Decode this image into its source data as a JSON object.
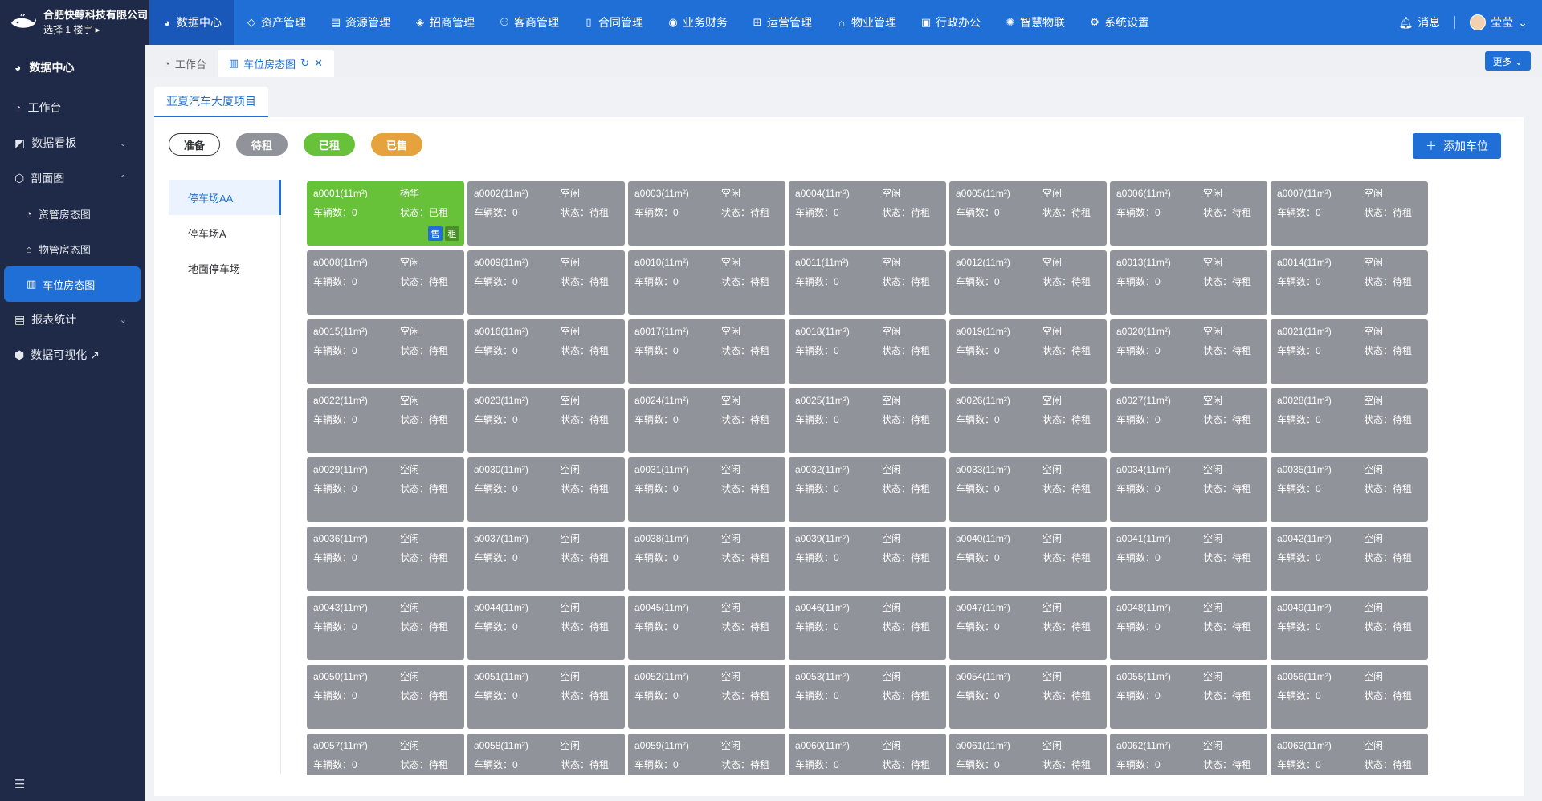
{
  "brand": {
    "company": "合肥快鲸科技有限公司",
    "building": "选择 1 楼宇 ▸"
  },
  "topnav": [
    {
      "label": "数据中心",
      "icon": "pie-chart-icon"
    },
    {
      "label": "资产管理",
      "icon": "box-icon"
    },
    {
      "label": "资源管理",
      "icon": "building-icon"
    },
    {
      "label": "招商管理",
      "icon": "tag-icon"
    },
    {
      "label": "客商管理",
      "icon": "users-icon"
    },
    {
      "label": "合同管理",
      "icon": "document-icon"
    },
    {
      "label": "业务财务",
      "icon": "finance-icon"
    },
    {
      "label": "运营管理",
      "icon": "operation-icon"
    },
    {
      "label": "物业管理",
      "icon": "home-icon"
    },
    {
      "label": "行政办公",
      "icon": "office-icon"
    },
    {
      "label": "智慧物联",
      "icon": "iot-icon"
    },
    {
      "label": "系统设置",
      "icon": "gear-icon"
    }
  ],
  "header": {
    "messages": "消息",
    "user": "莹莹"
  },
  "sidebar": {
    "title": "数据中心",
    "items": [
      {
        "label": "工作台",
        "icon": "dashboard-icon",
        "arrow": ""
      },
      {
        "label": "数据看板",
        "icon": "chart-icon",
        "arrow": "⌄"
      },
      {
        "label": "剖面图",
        "icon": "section-icon",
        "arrow": "⌃"
      },
      {
        "label": "资管房态图",
        "icon": "pie-icon",
        "arrow": ""
      },
      {
        "label": "物管房态图",
        "icon": "house-icon",
        "arrow": ""
      },
      {
        "label": "车位房态图",
        "icon": "parking-icon",
        "arrow": ""
      },
      {
        "label": "报表统计",
        "icon": "report-icon",
        "arrow": "⌄"
      },
      {
        "label": "数据可视化 ↗",
        "icon": "visual-icon",
        "arrow": ""
      }
    ]
  },
  "tabs": [
    {
      "label": "工作台"
    },
    {
      "label": "车位房态图"
    }
  ],
  "more_label": "更多 ⌄",
  "project_tab": "亚夏汽车大厦项目",
  "legend": {
    "prep": "准备",
    "to_rent": "待租",
    "rented": "已租",
    "sold": "已售"
  },
  "add_button": "添加车位",
  "lots": [
    "停车场AA",
    "停车场A",
    "地面停车场"
  ],
  "colors": {
    "primary": "#1f6fd6",
    "idle": "#909399",
    "rented": "#67c23a",
    "sold": "#e6a23c",
    "sidebar": "#1e2a47"
  },
  "spaces": [
    {
      "name": "a0001(11m²)",
      "usage": "杨华",
      "vehicles": "车辆数：0",
      "status": "状态：已租",
      "highlight": true,
      "badge_sell": "售",
      "badge_rent": "租"
    },
    {
      "name": "a0002(11m²)",
      "usage": "空闲",
      "vehicles": "车辆数：0",
      "status": "状态：待租"
    },
    {
      "name": "a0003(11m²)",
      "usage": "空闲",
      "vehicles": "车辆数：0",
      "status": "状态：待租"
    },
    {
      "name": "a0004(11m²)",
      "usage": "空闲",
      "vehicles": "车辆数：0",
      "status": "状态：待租"
    },
    {
      "name": "a0005(11m²)",
      "usage": "空闲",
      "vehicles": "车辆数：0",
      "status": "状态：待租"
    },
    {
      "name": "a0006(11m²)",
      "usage": "空闲",
      "vehicles": "车辆数：0",
      "status": "状态：待租"
    },
    {
      "name": "a0007(11m²)",
      "usage": "空闲",
      "vehicles": "车辆数：0",
      "status": "状态：待租"
    },
    {
      "name": "a0008(11m²)",
      "usage": "空闲",
      "vehicles": "车辆数：0",
      "status": "状态：待租"
    },
    {
      "name": "a0009(11m²)",
      "usage": "空闲",
      "vehicles": "车辆数：0",
      "status": "状态：待租"
    },
    {
      "name": "a0010(11m²)",
      "usage": "空闲",
      "vehicles": "车辆数：0",
      "status": "状态：待租"
    },
    {
      "name": "a0011(11m²)",
      "usage": "空闲",
      "vehicles": "车辆数：0",
      "status": "状态：待租"
    },
    {
      "name": "a0012(11m²)",
      "usage": "空闲",
      "vehicles": "车辆数：0",
      "status": "状态：待租"
    },
    {
      "name": "a0013(11m²)",
      "usage": "空闲",
      "vehicles": "车辆数：0",
      "status": "状态：待租"
    },
    {
      "name": "a0014(11m²)",
      "usage": "空闲",
      "vehicles": "车辆数：0",
      "status": "状态：待租"
    },
    {
      "name": "a0015(11m²)",
      "usage": "空闲",
      "vehicles": "车辆数：0",
      "status": "状态：待租"
    },
    {
      "name": "a0016(11m²)",
      "usage": "空闲",
      "vehicles": "车辆数：0",
      "status": "状态：待租"
    },
    {
      "name": "a0017(11m²)",
      "usage": "空闲",
      "vehicles": "车辆数：0",
      "status": "状态：待租"
    },
    {
      "name": "a0018(11m²)",
      "usage": "空闲",
      "vehicles": "车辆数：0",
      "status": "状态：待租"
    },
    {
      "name": "a0019(11m²)",
      "usage": "空闲",
      "vehicles": "车辆数：0",
      "status": "状态：待租"
    },
    {
      "name": "a0020(11m²)",
      "usage": "空闲",
      "vehicles": "车辆数：0",
      "status": "状态：待租"
    },
    {
      "name": "a0021(11m²)",
      "usage": "空闲",
      "vehicles": "车辆数：0",
      "status": "状态：待租"
    },
    {
      "name": "a0022(11m²)",
      "usage": "空闲",
      "vehicles": "车辆数：0",
      "status": "状态：待租"
    },
    {
      "name": "a0023(11m²)",
      "usage": "空闲",
      "vehicles": "车辆数：0",
      "status": "状态：待租"
    },
    {
      "name": "a0024(11m²)",
      "usage": "空闲",
      "vehicles": "车辆数：0",
      "status": "状态：待租"
    },
    {
      "name": "a0025(11m²)",
      "usage": "空闲",
      "vehicles": "车辆数：0",
      "status": "状态：待租"
    },
    {
      "name": "a0026(11m²)",
      "usage": "空闲",
      "vehicles": "车辆数：0",
      "status": "状态：待租"
    },
    {
      "name": "a0027(11m²)",
      "usage": "空闲",
      "vehicles": "车辆数：0",
      "status": "状态：待租"
    },
    {
      "name": "a0028(11m²)",
      "usage": "空闲",
      "vehicles": "车辆数：0",
      "status": "状态：待租"
    },
    {
      "name": "a0029(11m²)",
      "usage": "空闲",
      "vehicles": "车辆数：0",
      "status": "状态：待租"
    },
    {
      "name": "a0030(11m²)",
      "usage": "空闲",
      "vehicles": "车辆数：0",
      "status": "状态：待租"
    },
    {
      "name": "a0031(11m²)",
      "usage": "空闲",
      "vehicles": "车辆数：0",
      "status": "状态：待租"
    },
    {
      "name": "a0032(11m²)",
      "usage": "空闲",
      "vehicles": "车辆数：0",
      "status": "状态：待租"
    },
    {
      "name": "a0033(11m²)",
      "usage": "空闲",
      "vehicles": "车辆数：0",
      "status": "状态：待租"
    },
    {
      "name": "a0034(11m²)",
      "usage": "空闲",
      "vehicles": "车辆数：0",
      "status": "状态：待租"
    },
    {
      "name": "a0035(11m²)",
      "usage": "空闲",
      "vehicles": "车辆数：0",
      "status": "状态：待租"
    },
    {
      "name": "a0036(11m²)",
      "usage": "空闲",
      "vehicles": "车辆数：0",
      "status": "状态：待租"
    },
    {
      "name": "a0037(11m²)",
      "usage": "空闲",
      "vehicles": "车辆数：0",
      "status": "状态：待租"
    },
    {
      "name": "a0038(11m²)",
      "usage": "空闲",
      "vehicles": "车辆数：0",
      "status": "状态：待租"
    },
    {
      "name": "a0039(11m²)",
      "usage": "空闲",
      "vehicles": "车辆数：0",
      "status": "状态：待租"
    },
    {
      "name": "a0040(11m²)",
      "usage": "空闲",
      "vehicles": "车辆数：0",
      "status": "状态：待租"
    },
    {
      "name": "a0041(11m²)",
      "usage": "空闲",
      "vehicles": "车辆数：0",
      "status": "状态：待租"
    },
    {
      "name": "a0042(11m²)",
      "usage": "空闲",
      "vehicles": "车辆数：0",
      "status": "状态：待租"
    },
    {
      "name": "a0043(11m²)",
      "usage": "空闲",
      "vehicles": "车辆数：0",
      "status": "状态：待租"
    },
    {
      "name": "a0044(11m²)",
      "usage": "空闲",
      "vehicles": "车辆数：0",
      "status": "状态：待租"
    },
    {
      "name": "a0045(11m²)",
      "usage": "空闲",
      "vehicles": "车辆数：0",
      "status": "状态：待租"
    },
    {
      "name": "a0046(11m²)",
      "usage": "空闲",
      "vehicles": "车辆数：0",
      "status": "状态：待租"
    },
    {
      "name": "a0047(11m²)",
      "usage": "空闲",
      "vehicles": "车辆数：0",
      "status": "状态：待租"
    },
    {
      "name": "a0048(11m²)",
      "usage": "空闲",
      "vehicles": "车辆数：0",
      "status": "状态：待租"
    },
    {
      "name": "a0049(11m²)",
      "usage": "空闲",
      "vehicles": "车辆数：0",
      "status": "状态：待租"
    },
    {
      "name": "a0050(11m²)",
      "usage": "空闲",
      "vehicles": "车辆数：0",
      "status": "状态：待租"
    },
    {
      "name": "a0051(11m²)",
      "usage": "空闲",
      "vehicles": "车辆数：0",
      "status": "状态：待租"
    },
    {
      "name": "a0052(11m²)",
      "usage": "空闲",
      "vehicles": "车辆数：0",
      "status": "状态：待租"
    },
    {
      "name": "a0053(11m²)",
      "usage": "空闲",
      "vehicles": "车辆数：0",
      "status": "状态：待租"
    },
    {
      "name": "a0054(11m²)",
      "usage": "空闲",
      "vehicles": "车辆数：0",
      "status": "状态：待租"
    },
    {
      "name": "a0055(11m²)",
      "usage": "空闲",
      "vehicles": "车辆数：0",
      "status": "状态：待租"
    },
    {
      "name": "a0056(11m²)",
      "usage": "空闲",
      "vehicles": "车辆数：0",
      "status": "状态：待租"
    },
    {
      "name": "a0057(11m²)",
      "usage": "空闲",
      "vehicles": "车辆数：0",
      "status": "状态：待租"
    },
    {
      "name": "a0058(11m²)",
      "usage": "空闲",
      "vehicles": "车辆数：0",
      "status": "状态：待租"
    },
    {
      "name": "a0059(11m²)",
      "usage": "空闲",
      "vehicles": "车辆数：0",
      "status": "状态：待租"
    },
    {
      "name": "a0060(11m²)",
      "usage": "空闲",
      "vehicles": "车辆数：0",
      "status": "状态：待租"
    },
    {
      "name": "a0061(11m²)",
      "usage": "空闲",
      "vehicles": "车辆数：0",
      "status": "状态：待租"
    },
    {
      "name": "a0062(11m²)",
      "usage": "空闲",
      "vehicles": "车辆数：0",
      "status": "状态：待租"
    },
    {
      "name": "a0063(11m²)",
      "usage": "空闲",
      "vehicles": "车辆数：0",
      "status": "状态：待租"
    }
  ]
}
